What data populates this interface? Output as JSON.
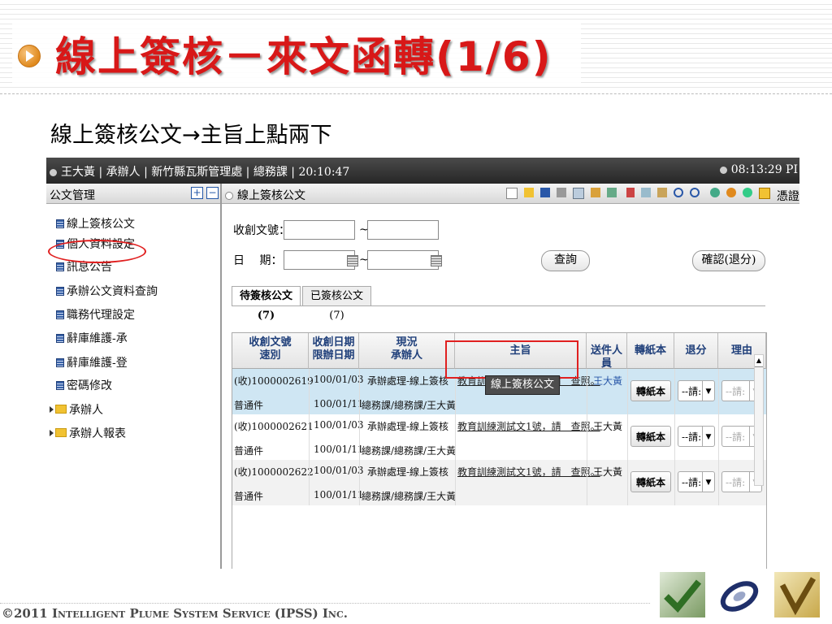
{
  "slide": {
    "title": "線上簽核－來文函轉(1/6)",
    "subtitle": "線上簽核公文→主旨上點兩下",
    "footer": "©2011 Intelligent Plume System Service (IPSS) Inc."
  },
  "topbar": {
    "left_text": "王大黃 | 承辦人 | 新竹縣瓦斯管理處 | 總務課 | 20:10:47",
    "right_text": "08:13:29 PI"
  },
  "sidebar": {
    "header": "公文管理",
    "expand": "+",
    "collapse": "−",
    "items": [
      {
        "label": "線上簽核公文",
        "type": "doc"
      },
      {
        "label": "個人資料設定",
        "type": "doc"
      },
      {
        "label": "訊息公告",
        "type": "doc"
      },
      {
        "label": "承辦公文資料查詢",
        "type": "doc"
      },
      {
        "label": "職務代理設定",
        "type": "doc"
      },
      {
        "label": "辭庫維護-承",
        "type": "doc"
      },
      {
        "label": "辭庫維護-登",
        "type": "doc"
      },
      {
        "label": "密碼修改",
        "type": "doc"
      },
      {
        "label": "承辦人",
        "type": "folder"
      },
      {
        "label": "承辦人報表",
        "type": "folder"
      }
    ]
  },
  "main": {
    "panel_title": "線上簽核公文",
    "toolbar_last": "憑證",
    "form": {
      "doc_no_label": "收創文號：",
      "date_label": "日　 期：",
      "range_sep": "~",
      "query_button": "查詢",
      "confirm_button": "確認(退分)"
    },
    "tabs": [
      "待簽核公文(7)",
      "已簽核公文(7)"
    ],
    "columns": [
      [
        "收創文號",
        "速別"
      ],
      [
        "收創日期",
        "限辦日期"
      ],
      [
        "現況",
        "承辦人"
      ],
      [
        "主旨"
      ],
      [
        "送件人員"
      ],
      [
        "轉紙本"
      ],
      [
        "退分"
      ],
      [
        "理由"
      ]
    ],
    "rows": [
      {
        "doc_no": "(收)1000002619",
        "speed": "普通件",
        "date": "100/01/03",
        "due": "100/01/11",
        "status": "承辦處理-線上簽核",
        "handler": "總務課/總務課/王大黃",
        "subject": "教育訓練測試文1號，請　查照。",
        "sender": "王大黃",
        "paper_btn": "轉紙本",
        "return_sel": "--請:",
        "reason_sel": "--請:"
      },
      {
        "doc_no": "(收)1000002621",
        "speed": "普通件",
        "date": "100/01/03",
        "due": "100/01/11",
        "status": "承辦處理-線上簽核",
        "handler": "總務課/總務課/王大黃",
        "subject": "教育訓練測試文1號，請　查照。",
        "sender": "王大黃",
        "paper_btn": "轉紙本",
        "return_sel": "--請:",
        "reason_sel": "--請:"
      },
      {
        "doc_no": "(收)1000002622",
        "speed": "普通件",
        "date": "100/01/03",
        "due": "100/01/11",
        "status": "承辦處理-線上簽核",
        "handler": "總務課/總務課/王大黃",
        "subject": "教育訓練測試文1號，請　查照。",
        "sender": "王大黃",
        "paper_btn": "轉紙本",
        "return_sel": "--請:",
        "reason_sel": "--請:"
      }
    ],
    "tooltip": "線上簽核公文"
  },
  "colors": {
    "title": "#d81818",
    "row_highlight": "#cfe6f3",
    "row_alt": "#f2f2f2",
    "callout": "#e02020"
  },
  "icons": [
    "play-bullet-icon",
    "new-doc-icon",
    "open-folder-icon",
    "save-icon",
    "print-icon",
    "preview-icon",
    "spell-icon",
    "table-icon",
    "cut-icon",
    "copy-icon",
    "paste-icon",
    "undo-icon",
    "redo-icon",
    "find-icon",
    "zoom-icon",
    "replace-icon",
    "lock-icon"
  ]
}
